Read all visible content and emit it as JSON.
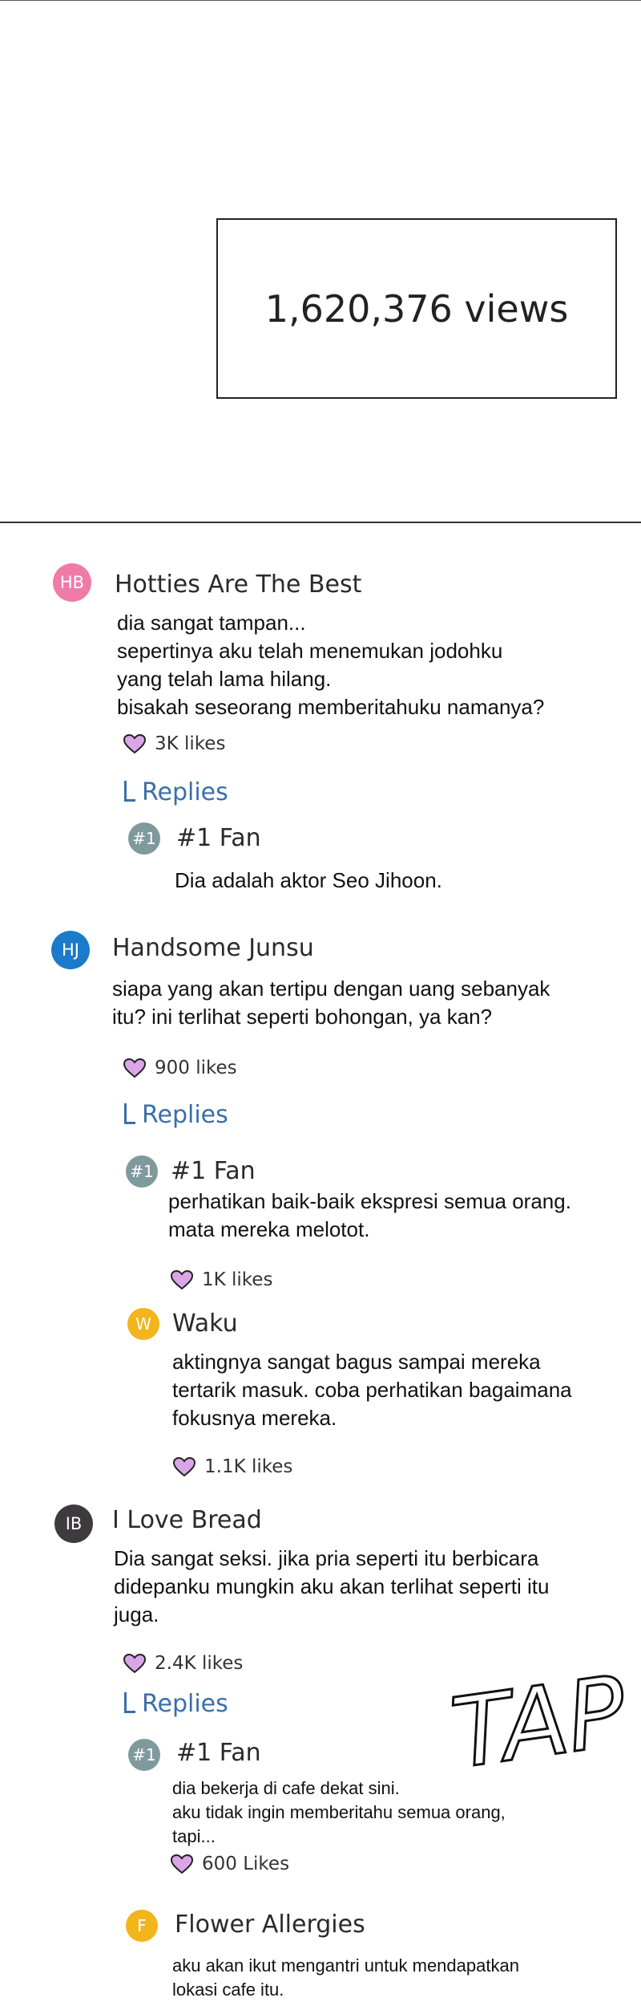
{
  "views": "1,620,376 views",
  "comments": [
    {
      "initials": "HB",
      "color": "#f07aa8",
      "name": "Hotties Are The Best",
      "lines": [
        "dia sangat tampan...",
        "sepertinya aku telah menemukan jodohku",
        "yang telah lama hilang.",
        "bisakah seseorang memberitahuku namanya?"
      ],
      "likes": "3K likes",
      "replies_label": "Replies",
      "replies": [
        {
          "initials": "#1",
          "color": "#7f9a9c",
          "name": "#1 Fan",
          "lines": [
            "Dia adalah aktor Seo Jihoon."
          ]
        }
      ]
    },
    {
      "initials": "HJ",
      "color": "#1b7ac9",
      "name": "Handsome Junsu",
      "lines": [
        "siapa yang akan tertipu dengan uang sebanyak",
        "itu?  ini terlihat seperti bohongan, ya kan?"
      ],
      "likes": "900 likes",
      "replies_label": "Replies",
      "replies": [
        {
          "initials": "#1",
          "color": "#7f9a9c",
          "name": "#1 Fan",
          "lines": [
            "perhatikan baik-baik ekspresi semua orang.",
            "mata mereka melotot."
          ],
          "likes": "1K likes"
        },
        {
          "initials": "W",
          "color": "#f2b51c",
          "name": "Waku",
          "lines": [
            "aktingnya sangat bagus sampai mereka",
            "tertarik masuk. coba perhatikan bagaimana",
            "fokusnya mereka."
          ],
          "likes": "1.1K likes"
        }
      ]
    },
    {
      "initials": "IB",
      "color": "#3e3a3d",
      "name": "I Love Bread",
      "lines": [
        "Dia sangat seksi. jika pria seperti itu berbicara",
        "didepanku mungkin aku akan terlihat seperti itu",
        "juga."
      ],
      "likes": "2.4K likes",
      "replies_label": "Replies",
      "replies": [
        {
          "initials": "#1",
          "color": "#7f9a9c",
          "name": "#1 Fan",
          "lines": [
            "dia bekerja di cafe dekat sini.",
            "aku tidak ingin memberitahu semua orang,",
            "tapi..."
          ],
          "likes": "600 Likes"
        },
        {
          "initials": "F",
          "color": "#f2b51c",
          "name": "Flower Allergies",
          "lines": [
            "aku akan ikut mengantri untuk mendapatkan",
            "lokasi cafe itu."
          ]
        }
      ]
    }
  ],
  "sfx": "TAP",
  "colors": {
    "replies": "#3a6fa8",
    "heart_fill": "#d9a6e8",
    "heart_stroke": "#222222"
  }
}
